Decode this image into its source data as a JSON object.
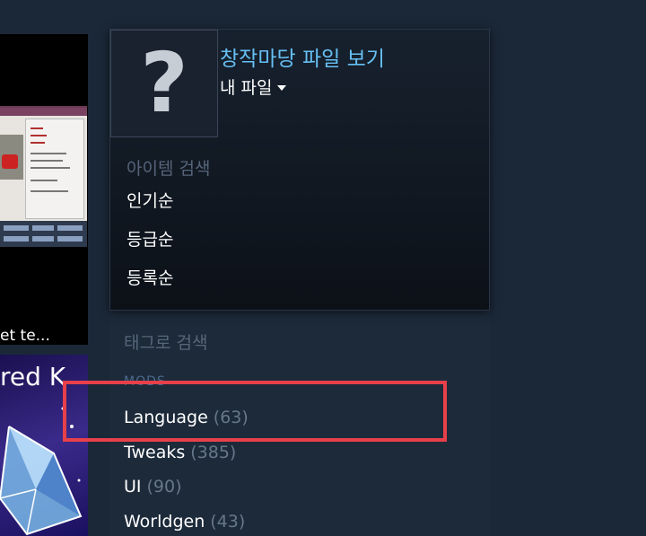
{
  "hub": {
    "title": "창작마당 파일 보기",
    "subtitle": "내 파일",
    "placeholder_icon": "question-mark-icon"
  },
  "browse": {
    "label": "아이템 검색",
    "items": [
      "인기순",
      "등급순",
      "등록순"
    ]
  },
  "tags": {
    "label": "태그로 검색",
    "category": "MODS",
    "items": [
      {
        "name": "Language",
        "count": "(63)"
      },
      {
        "name": "Tweaks",
        "count": "(385)"
      },
      {
        "name": "UI",
        "count": "(90)"
      },
      {
        "name": "Worldgen",
        "count": "(43)"
      }
    ]
  },
  "thumbnails": {
    "caption1": "et te...",
    "title2": "red K"
  },
  "colors": {
    "accent": "#66c0f4",
    "highlight": "#e8404a",
    "background": "#1b2838"
  }
}
